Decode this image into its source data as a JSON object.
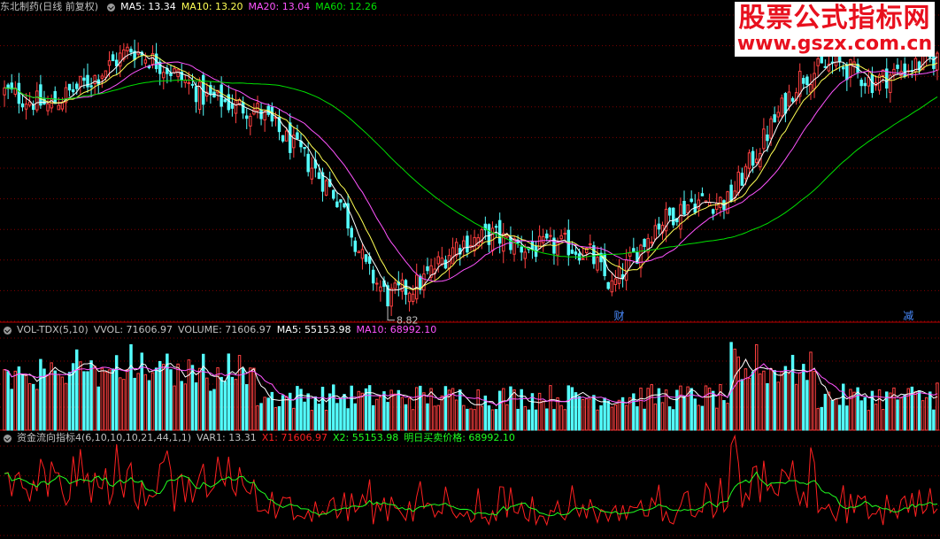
{
  "main_panel": {
    "stock_name": "东北制药(日线 前复权)",
    "ma5": "MA5: 13.34",
    "ma10": "MA10: 13.20",
    "ma20": "MA20: 13.04",
    "ma60": "MA60: 12.26",
    "low_label": "8.82",
    "event_labels": [
      "财",
      "减"
    ]
  },
  "volume_panel": {
    "name": "VOL-TDX(5,10)",
    "vvol": "VVOL: 71606.97",
    "volume": "VOLUME: 71606.97",
    "ma5": "MA5: 55153.98",
    "ma10": "MA10: 68992.10"
  },
  "indicator_panel": {
    "name": "资金流向指标4(6,10,10,10,21,44,1,1)",
    "var1": "VAR1: 13.31",
    "x1": "X1: 71606.97",
    "x2": "X2: 55153.98",
    "tomorrow": "明日买卖价格: 68992.10"
  },
  "watermark": {
    "line1": "股票公式指标网",
    "line2": "www.gszx.com.cn"
  },
  "colors": {
    "up": "#ff4040",
    "down": "#54ffff",
    "ma5": "#ffffff",
    "ma10": "#ffff54",
    "ma20": "#ff54ff",
    "ma60": "#00e000",
    "grid": "#800000",
    "x1": "#ff2020",
    "x2": "#20ff20"
  },
  "chart_data": {
    "type": "candlestick",
    "low_marker": 8.82,
    "y_range": [
      8.5,
      14.9
    ],
    "close_keypoints": [
      [
        0,
        13.3
      ],
      [
        12,
        13.0
      ],
      [
        25,
        13.6
      ],
      [
        35,
        14.2
      ],
      [
        45,
        13.8
      ],
      [
        55,
        13.2
      ],
      [
        70,
        12.9
      ],
      [
        82,
        12.0
      ],
      [
        93,
        11.0
      ],
      [
        100,
        9.6
      ],
      [
        106,
        9.0
      ],
      [
        115,
        9.3
      ],
      [
        125,
        10.1
      ],
      [
        135,
        10.3
      ],
      [
        145,
        10.0
      ],
      [
        155,
        10.1
      ],
      [
        162,
        9.9
      ],
      [
        168,
        9.2
      ],
      [
        180,
        10.5
      ],
      [
        190,
        11.0
      ],
      [
        200,
        11.0
      ],
      [
        210,
        12.3
      ],
      [
        220,
        13.6
      ],
      [
        230,
        13.9
      ],
      [
        240,
        13.5
      ],
      [
        250,
        13.8
      ],
      [
        258,
        14.0
      ]
    ],
    "volume_range": [
      0,
      140000
    ],
    "volume_last": 71606.97,
    "volume_ma5": 55153.98,
    "volume_ma10": 68992.1,
    "indicator_last": {
      "var1": 13.31,
      "x1": 71606.97,
      "x2": 55153.98,
      "tomorrow": 68992.1
    }
  }
}
